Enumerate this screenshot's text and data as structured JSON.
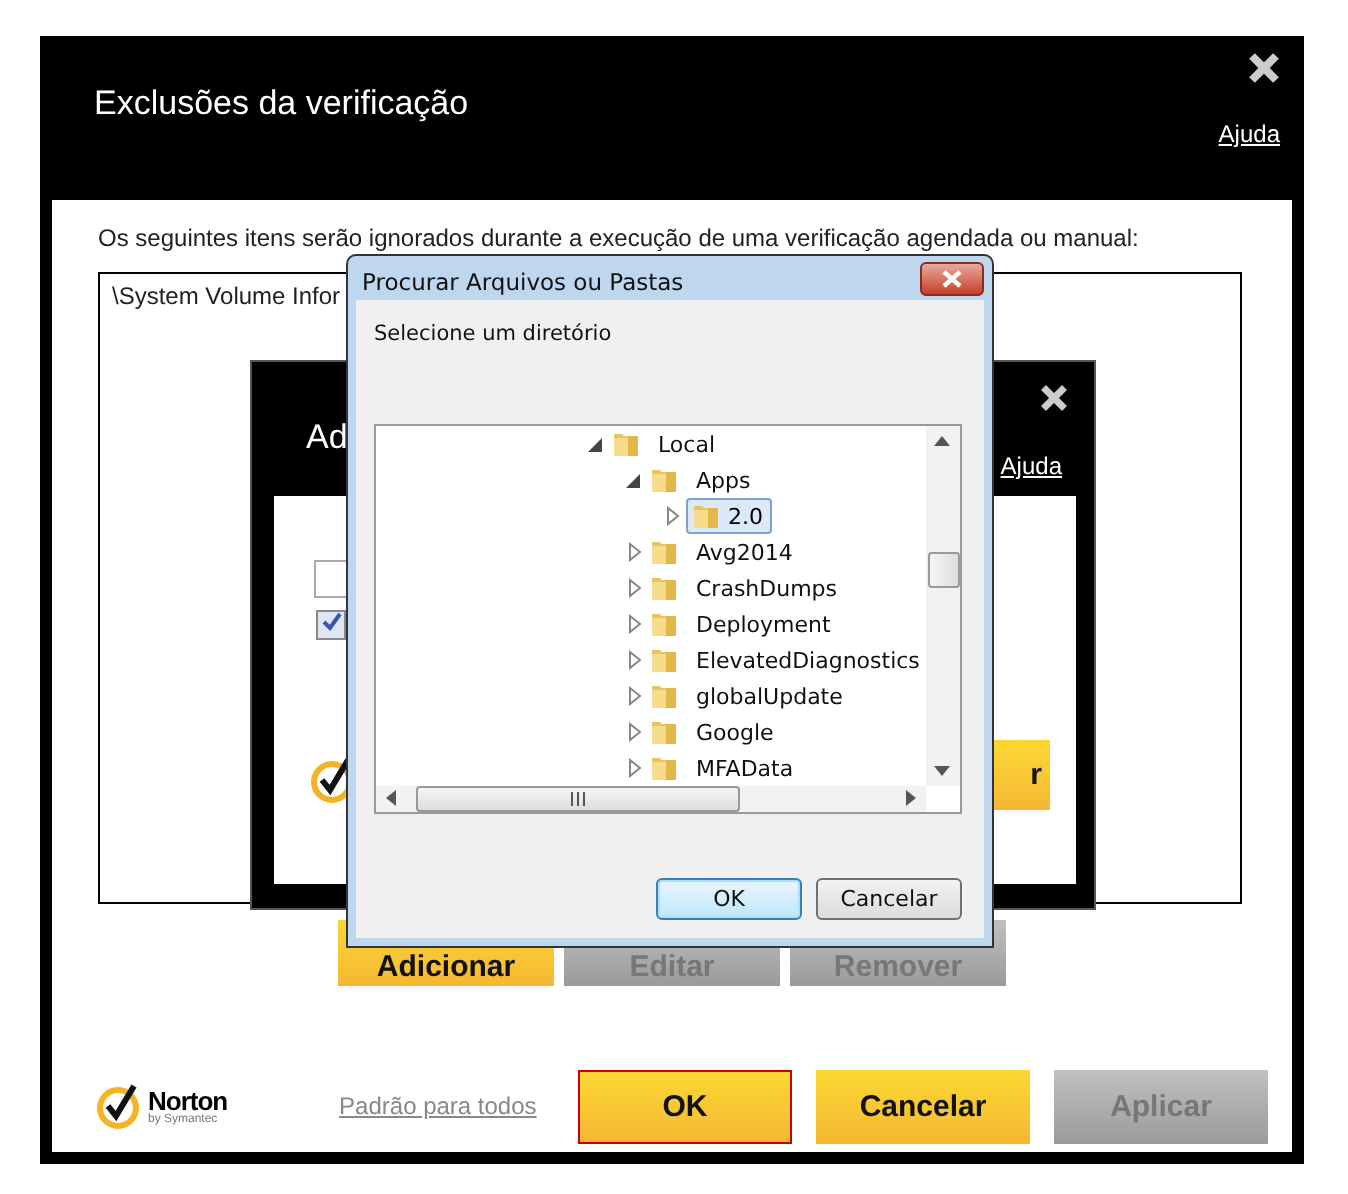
{
  "main_window": {
    "title": "Exclusões da verificação",
    "help_link": "Ajuda",
    "description": "Os seguintes itens serão ignorados durante a execução de uma verificação agendada ou manual:",
    "items": [
      "\\System Volume Infor"
    ],
    "buttons": [
      {
        "label": "Adicionar",
        "disabled": false
      },
      {
        "label": "Editar",
        "disabled": true
      },
      {
        "label": "Remover",
        "disabled": true
      }
    ],
    "footer": {
      "logo": {
        "name": "Norton",
        "tagline": "by Symantec"
      },
      "defaults_link": "Padrão para todos",
      "buttons": [
        {
          "label": "OK",
          "disabled": false,
          "focused": true
        },
        {
          "label": "Cancelar",
          "disabled": false,
          "focused": false
        },
        {
          "label": "Aplicar",
          "disabled": true,
          "focused": false
        }
      ]
    }
  },
  "inner_dialog": {
    "title": "Ad",
    "help_link": "Ajuda",
    "checkbox": {
      "checked": true
    },
    "button": "r"
  },
  "browse_dialog": {
    "title": "Procurar Arquivos ou Pastas",
    "prompt": "Selecione um diretório",
    "tree": [
      {
        "label": "Local",
        "expanded": true,
        "selected": false,
        "children": [
          {
            "label": "Apps",
            "expanded": true,
            "selected": false,
            "children": [
              {
                "label": "2.0",
                "expanded": false,
                "selected": true
              }
            ]
          },
          {
            "label": "Avg2014",
            "expanded": false,
            "selected": false
          },
          {
            "label": "CrashDumps",
            "expanded": false,
            "selected": false
          },
          {
            "label": "Deployment",
            "expanded": false,
            "selected": false
          },
          {
            "label": "ElevatedDiagnostics",
            "expanded": false,
            "selected": false
          },
          {
            "label": "globalUpdate",
            "expanded": false,
            "selected": false
          },
          {
            "label": "Google",
            "expanded": false,
            "selected": false
          },
          {
            "label": "MFAData",
            "expanded": false,
            "selected": false
          }
        ]
      }
    ],
    "buttons": [
      {
        "label": "OK",
        "default": true
      },
      {
        "label": "Cancelar",
        "default": false
      }
    ]
  }
}
